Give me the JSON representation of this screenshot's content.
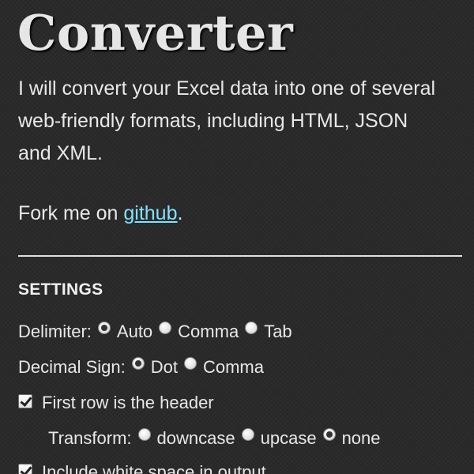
{
  "header": {
    "title": "Converter"
  },
  "intro": {
    "text": "I will convert your Excel data into one of several web-friendly formats, including HTML, JSON and XML."
  },
  "fork": {
    "prefix": "Fork me on ",
    "link_text": "github",
    "suffix": "."
  },
  "settings": {
    "title": "SETTINGS",
    "delimiter": {
      "label": "Delimiter:",
      "options": [
        "Auto",
        "Comma",
        "Tab"
      ],
      "selected": "Auto"
    },
    "decimal_sign": {
      "label": "Decimal Sign:",
      "options": [
        "Dot",
        "Comma"
      ],
      "selected": "Dot"
    },
    "first_row_header": {
      "label": "First row is the header",
      "checked": true
    },
    "transform": {
      "label": "Transform:",
      "options": [
        "downcase",
        "upcase",
        "none"
      ],
      "selected": "none"
    },
    "include_whitespace": {
      "label": "Include white space in output",
      "checked": true
    }
  },
  "colors": {
    "background": "#2a2a2a",
    "text": "#e8e8e8",
    "link": "#7fe3ff"
  }
}
